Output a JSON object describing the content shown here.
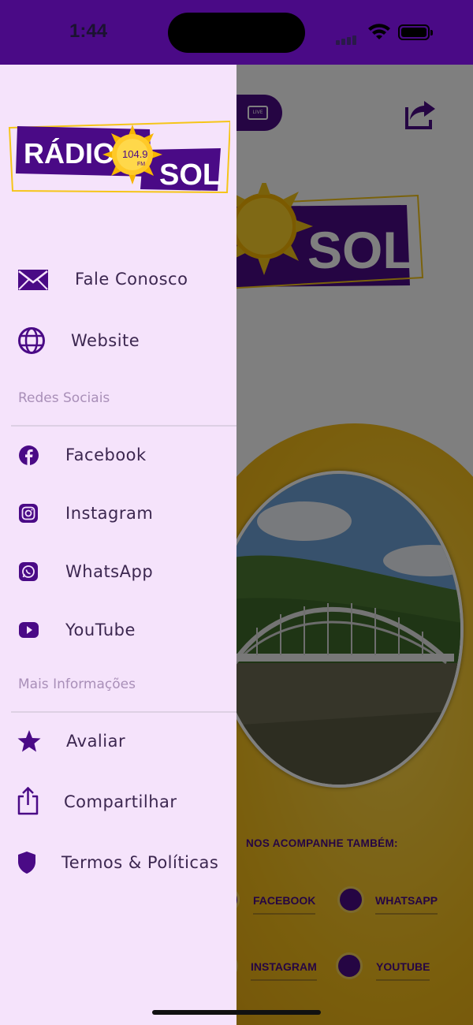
{
  "status_bar": {
    "time": "1:44",
    "bg_color": "#4a0a86"
  },
  "background_app": {
    "follow_title": "NOS ACOMPANHE TAMBÉM:",
    "live_label": "LIVE",
    "social_links": [
      "FACEBOOK",
      "WHATSAPP",
      "INSTAGRAM",
      "YOUTUBE"
    ]
  },
  "drawer": {
    "logo": {
      "word1": "RÁDIO",
      "word2": "SOL",
      "frequency": "104.9",
      "band": "FM"
    },
    "contact_items": [
      {
        "label": "Fale Conosco",
        "icon": "mail-icon"
      },
      {
        "label": "Website",
        "icon": "globe-icon"
      }
    ],
    "social_section_title": "Redes Sociais",
    "social_items": [
      {
        "label": "Facebook",
        "icon": "facebook-icon"
      },
      {
        "label": "Instagram",
        "icon": "instagram-icon"
      },
      {
        "label": "WhatsApp",
        "icon": "whatsapp-icon"
      },
      {
        "label": "YouTube",
        "icon": "youtube-icon"
      }
    ],
    "info_section_title": "Mais Informações",
    "info_items": [
      {
        "label": "Avaliar",
        "icon": "star-icon"
      },
      {
        "label": "Compartilhar",
        "icon": "share-icon"
      },
      {
        "label": "Termos & Políticas",
        "icon": "shield-icon"
      }
    ]
  },
  "colors": {
    "brand_purple": "#4a0a86",
    "brand_yellow": "#f5c518",
    "drawer_bg": "#f5e3fb",
    "section_title": "#a98fb8"
  }
}
